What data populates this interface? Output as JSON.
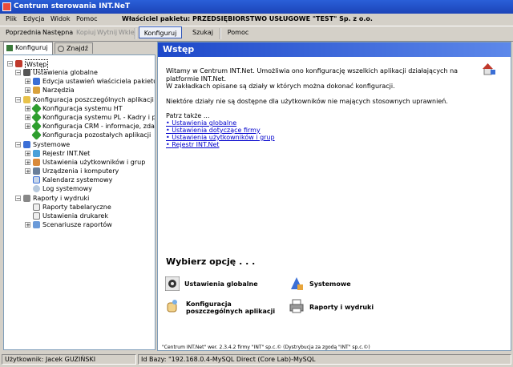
{
  "window": {
    "title": "Centrum sterowania INT.NeT"
  },
  "menu": {
    "items": [
      "Plik",
      "Edycja",
      "Widok",
      "Pomoc"
    ],
    "owner": "Właściciel pakietu: PRZEDSIĘBIORSTWO USŁUGOWE \"TEST\" Sp. z o.o."
  },
  "toolbar": {
    "prev": "Poprzednia",
    "next": "Następna",
    "copy": "Kopiuj",
    "cut": "Wytnij",
    "paste": "Wklej",
    "configure": "Konfiguruj",
    "search": "Szukaj",
    "help": "Pomoc"
  },
  "tabs": [
    "Konfiguruj",
    "Znajdź"
  ],
  "tree": {
    "root": "Wstęp",
    "items": [
      "Ustawienia globalne",
      "Edycja ustawień właściciela pakietu",
      "Narzędzia",
      "Konfiguracja poszczególnych aplikacji",
      "Konfiguracja systemu HT",
      "Konfiguracja systemu PL - Kadry i pł",
      "Konfiguracja CRM - informacje, zdar",
      "Konfiguracja pozostałych aplikacji",
      "Systemowe",
      "Rejestr INT.Net",
      "Ustawienia użytkowników i grup",
      "Urządzenia i komputery",
      "Kalendarz systemowy",
      "Log systemowy",
      "Raporty i wydruki",
      "Raporty tabelaryczne",
      "Ustawienia drukarek",
      "Scenariusze raportów"
    ]
  },
  "content": {
    "header": "Wstęp",
    "intro1": "Witamy w Centrum INT.Net. Umożliwia ono konfigurację wszelkich aplikacji działających na",
    "intro2": "platformie INT.Net.",
    "intro3": "W zakładkach opisane są działy w których można dokonać konfiguracji.",
    "intro4": "Niektóre działy nie są dostępne dla użytkowników nie mających stosownych uprawnień.",
    "see_also": "Patrz także ...",
    "links": [
      "Ustawienia globalne",
      "Ustawienia dotyczące firmy",
      "Ustawienia użytkowników i grup",
      "Rejestr INT.Net"
    ],
    "choose": "Wybierz opcję . . .",
    "options": {
      "global": "Ustawienia globalne",
      "system": "Systemowe",
      "apps1": "Konfiguracja",
      "apps2": "poszczególnych aplikacji",
      "reports": "Raporty i wydruki"
    },
    "footer": "\"Centrum INT.Net\" wer. 2.3.4.2 firmy \"INT\" sp.c.© (Dystrybucja za zgodą \"INT\" sp.c.©)"
  },
  "status": {
    "user": "Użytkownik: Jacek GUZIŃSKI",
    "db": "Id Bazy: \"192.168.0.4-MySQL Direct (Core Lab)-MySQL"
  }
}
